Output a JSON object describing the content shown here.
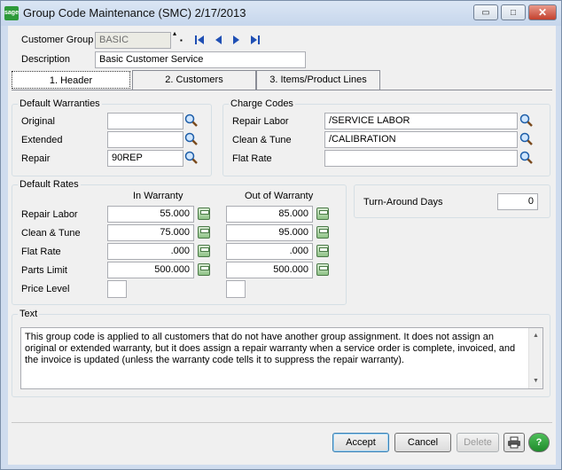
{
  "window": {
    "logo_text": "sage",
    "title": "Group Code Maintenance (SMC) 2/17/2013",
    "min_symbol": "▭",
    "max_symbol": "□",
    "close_symbol": "✕"
  },
  "header": {
    "customer_group_label": "Customer Group",
    "customer_group_value": "BASIC",
    "description_label": "Description",
    "description_value": "Basic Customer Service"
  },
  "tabs": [
    {
      "label": "1. Header"
    },
    {
      "label": "2. Customers"
    },
    {
      "label": "3. Items/Product Lines"
    }
  ],
  "default_warranties": {
    "title": "Default Warranties",
    "original_label": "Original",
    "original_value": "",
    "extended_label": "Extended",
    "extended_value": "",
    "repair_label": "Repair",
    "repair_value": "90REP"
  },
  "charge_codes": {
    "title": "Charge Codes",
    "repair_labor_label": "Repair Labor",
    "repair_labor_value": "/SERVICE LABOR",
    "clean_tune_label": "Clean & Tune",
    "clean_tune_value": "/CALIBRATION",
    "flat_rate_label": "Flat Rate",
    "flat_rate_value": ""
  },
  "default_rates": {
    "title": "Default Rates",
    "in_warranty_header": "In Warranty",
    "out_of_warranty_header": "Out of Warranty",
    "rows": [
      {
        "label": "Repair Labor",
        "in": "55.000",
        "out": "85.000"
      },
      {
        "label": "Clean & Tune",
        "in": "75.000",
        "out": "95.000"
      },
      {
        "label": "Flat Rate",
        "in": ".000",
        "out": ".000"
      },
      {
        "label": "Parts Limit",
        "in": "500.000",
        "out": "500.000"
      }
    ],
    "price_level_label": "Price Level",
    "price_level_in": "",
    "price_level_out": ""
  },
  "turnaround": {
    "label": "Turn-Around Days",
    "value": "0"
  },
  "text_section": {
    "title": "Text",
    "content": "This group code is applied to all customers that do not have another group assignment.  It does not assign an original or extended warranty, but it does assign a repair warranty when a service order is complete, invoiced, and the invoice is updated (unless the warranty code tells it to suppress the repair warranty)."
  },
  "buttons": {
    "accept": "Accept",
    "cancel": "Cancel",
    "delete": "Delete",
    "help_symbol": "?"
  }
}
